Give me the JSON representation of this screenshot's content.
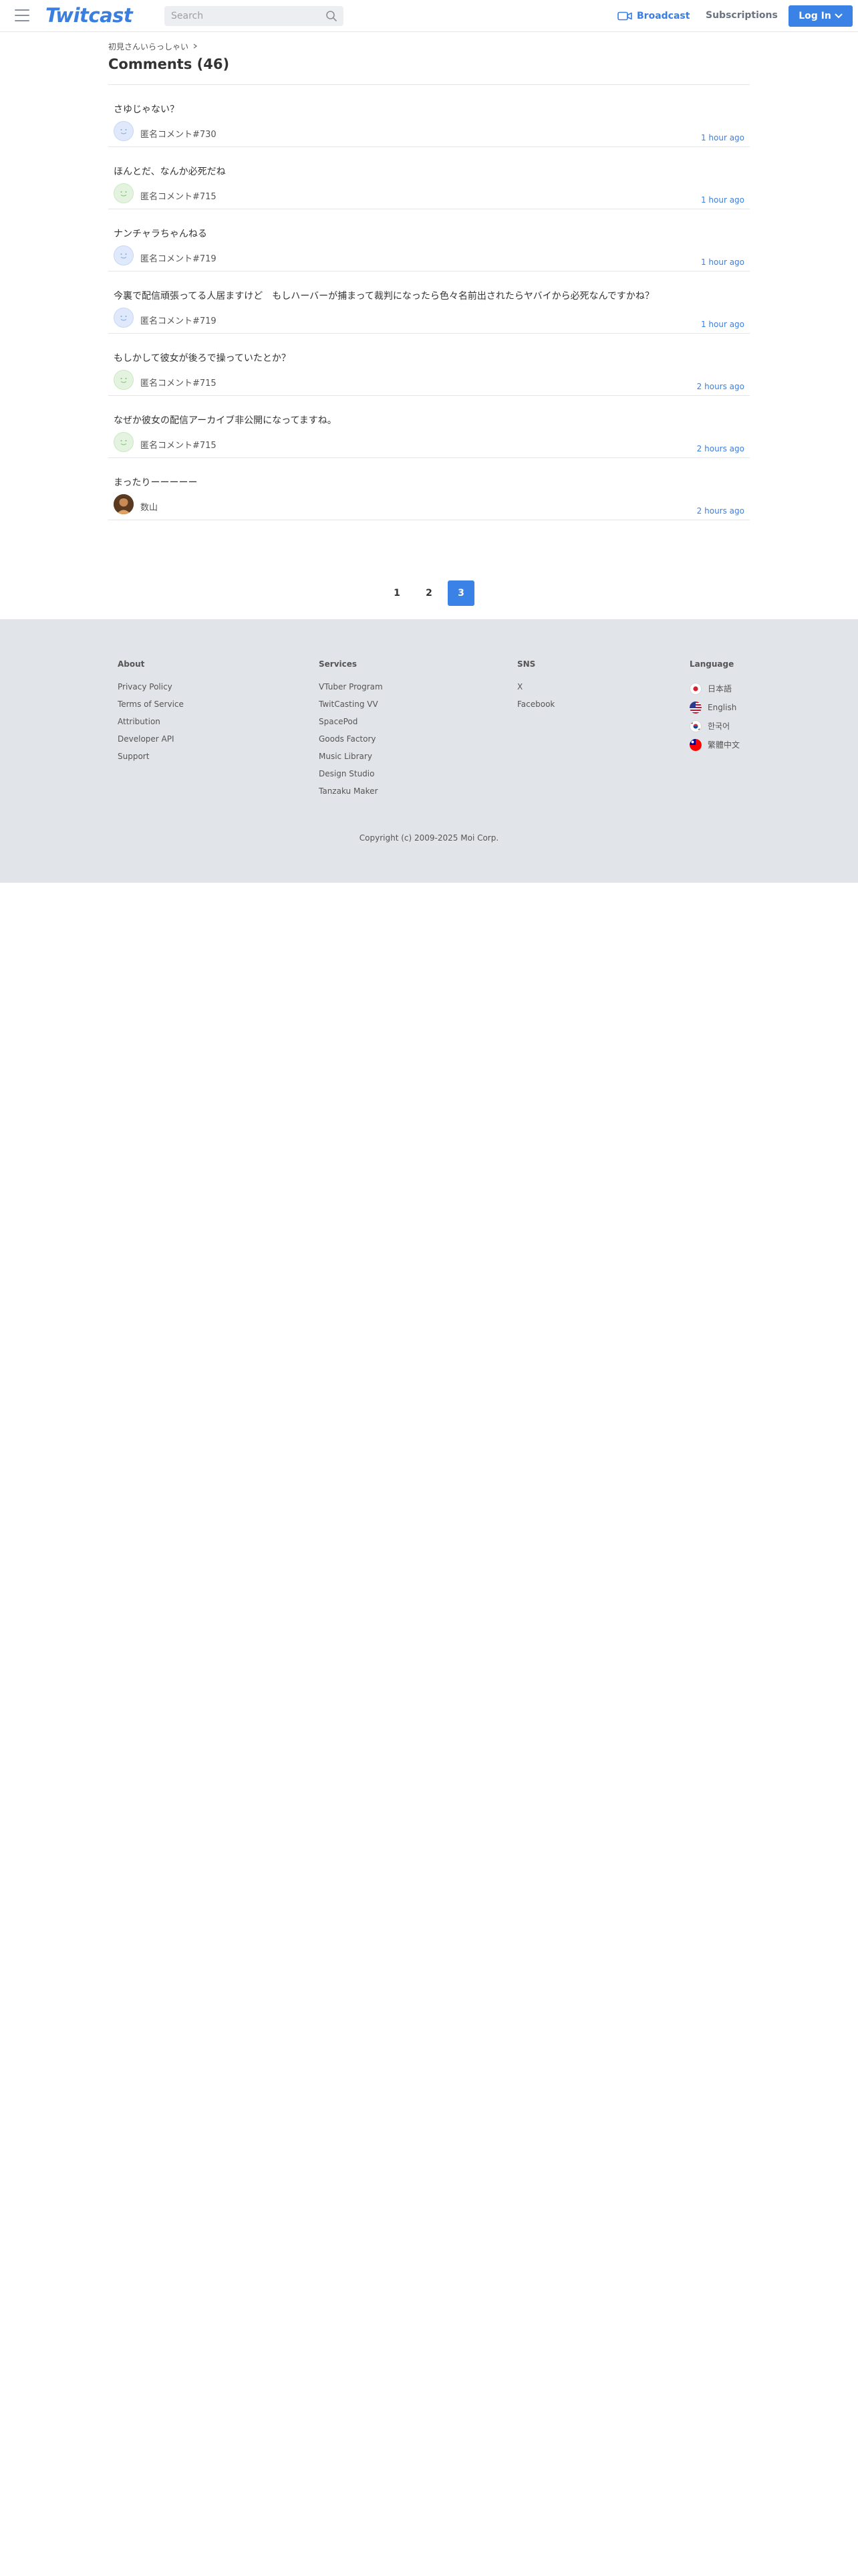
{
  "header": {
    "logo": "Twitcast",
    "search_placeholder": "Search",
    "broadcast_label": "Broadcast",
    "subscriptions_label": "Subscriptions",
    "login_label": "Log In",
    "accent_color": "#3b82e6"
  },
  "breadcrumb": {
    "text": "初見さんいらっしゃい"
  },
  "page": {
    "title": "Comments (46)"
  },
  "comments": [
    {
      "text": "さゆじゃない？",
      "author": "匿名コメント#730",
      "time": "1 hour ago",
      "avatar": "blue"
    },
    {
      "text": "ほんとだ、なんか必死だね",
      "author": "匿名コメント#715",
      "time": "1 hour ago",
      "avatar": "green"
    },
    {
      "text": "ナンチャラちゃんねる",
      "author": "匿名コメント#719",
      "time": "1 hour ago",
      "avatar": "blue"
    },
    {
      "text": "今裏で配信頑張ってる人居ますけど　もしハーバーが捕まって裁判になったら色々名前出されたらヤバイから必死なんですかね？",
      "author": "匿名コメント#719",
      "time": "1 hour ago",
      "avatar": "blue"
    },
    {
      "text": "もしかして彼女が後ろで操っていたとか？",
      "author": "匿名コメント#715",
      "time": "2 hours ago",
      "avatar": "green"
    },
    {
      "text": "なぜか彼女の配信アーカイブ非公開になってますね。",
      "author": "匿名コメント#715",
      "time": "2 hours ago",
      "avatar": "green"
    },
    {
      "text": "まったりーーーーー",
      "author": "数山",
      "time": "2 hours ago",
      "avatar": "photo"
    }
  ],
  "pagination": {
    "pages": [
      "1",
      "2",
      "3"
    ],
    "current": "3"
  },
  "footer": {
    "about": {
      "title": "About",
      "links": [
        "Privacy Policy",
        "Terms of Service",
        "Attribution",
        "Developer API",
        "Support"
      ]
    },
    "services": {
      "title": "Services",
      "links": [
        "VTuber Program",
        "TwitCasting VV",
        "SpacePod",
        "Goods Factory",
        "Music Library",
        "Design Studio",
        "Tanzaku Maker"
      ]
    },
    "sns": {
      "title": "SNS",
      "links": [
        "X",
        "Facebook"
      ]
    },
    "language": {
      "title": "Language",
      "items": [
        "日本語",
        "English",
        "한국어",
        "繁體中文"
      ]
    },
    "copyright": "Copyright (c) 2009-2025 Moi Corp."
  }
}
